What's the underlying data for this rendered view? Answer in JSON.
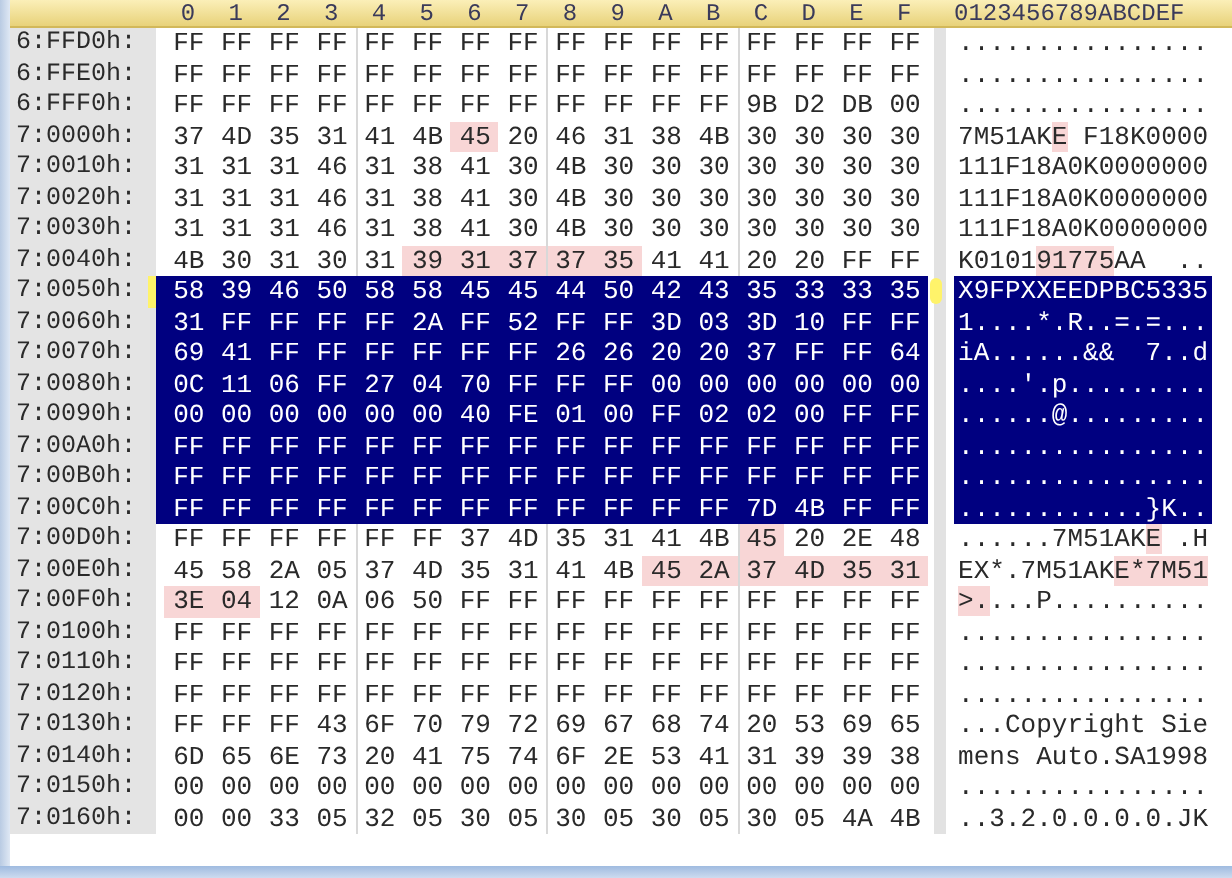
{
  "header": {
    "columns": [
      "0",
      "1",
      "2",
      "3",
      "4",
      "5",
      "6",
      "7",
      "8",
      "9",
      "A",
      "B",
      "C",
      "D",
      "E",
      "F"
    ],
    "ascii_title": "0123456789ABCDEF"
  },
  "rows": [
    {
      "address": "6:FFD0h:",
      "selected": false,
      "current": false,
      "bytes": [
        "FF",
        "FF",
        "FF",
        "FF",
        "FF",
        "FF",
        "FF",
        "FF",
        "FF",
        "FF",
        "FF",
        "FF",
        "FF",
        "FF",
        "FF",
        "FF"
      ],
      "highlighted": [
        false,
        false,
        false,
        false,
        false,
        false,
        false,
        false,
        false,
        false,
        false,
        false,
        false,
        false,
        false,
        false
      ],
      "ascii": "................"
    },
    {
      "address": "6:FFE0h:",
      "selected": false,
      "current": false,
      "bytes": [
        "FF",
        "FF",
        "FF",
        "FF",
        "FF",
        "FF",
        "FF",
        "FF",
        "FF",
        "FF",
        "FF",
        "FF",
        "FF",
        "FF",
        "FF",
        "FF"
      ],
      "highlighted": [
        false,
        false,
        false,
        false,
        false,
        false,
        false,
        false,
        false,
        false,
        false,
        false,
        false,
        false,
        false,
        false
      ],
      "ascii": "................"
    },
    {
      "address": "6:FFF0h:",
      "selected": false,
      "current": false,
      "bytes": [
        "FF",
        "FF",
        "FF",
        "FF",
        "FF",
        "FF",
        "FF",
        "FF",
        "FF",
        "FF",
        "FF",
        "FF",
        "9B",
        "D2",
        "DB",
        "00"
      ],
      "highlighted": [
        false,
        false,
        false,
        false,
        false,
        false,
        false,
        false,
        false,
        false,
        false,
        false,
        false,
        false,
        false,
        false
      ],
      "ascii": "................"
    },
    {
      "address": "7:0000h:",
      "selected": false,
      "current": false,
      "bytes": [
        "37",
        "4D",
        "35",
        "31",
        "41",
        "4B",
        "45",
        "20",
        "46",
        "31",
        "38",
        "4B",
        "30",
        "30",
        "30",
        "30"
      ],
      "highlighted": [
        false,
        false,
        false,
        false,
        false,
        false,
        true,
        false,
        false,
        false,
        false,
        false,
        false,
        false,
        false,
        false
      ],
      "ascii": "7M51AKE F18K0000"
    },
    {
      "address": "7:0010h:",
      "selected": false,
      "current": false,
      "bytes": [
        "31",
        "31",
        "31",
        "46",
        "31",
        "38",
        "41",
        "30",
        "4B",
        "30",
        "30",
        "30",
        "30",
        "30",
        "30",
        "30"
      ],
      "highlighted": [
        false,
        false,
        false,
        false,
        false,
        false,
        false,
        false,
        false,
        false,
        false,
        false,
        false,
        false,
        false,
        false
      ],
      "ascii": "111F18A0K0000000"
    },
    {
      "address": "7:0020h:",
      "selected": false,
      "current": false,
      "bytes": [
        "31",
        "31",
        "31",
        "46",
        "31",
        "38",
        "41",
        "30",
        "4B",
        "30",
        "30",
        "30",
        "30",
        "30",
        "30",
        "30"
      ],
      "highlighted": [
        false,
        false,
        false,
        false,
        false,
        false,
        false,
        false,
        false,
        false,
        false,
        false,
        false,
        false,
        false,
        false
      ],
      "ascii": "111F18A0K0000000"
    },
    {
      "address": "7:0030h:",
      "selected": false,
      "current": false,
      "bytes": [
        "31",
        "31",
        "31",
        "46",
        "31",
        "38",
        "41",
        "30",
        "4B",
        "30",
        "30",
        "30",
        "30",
        "30",
        "30",
        "30"
      ],
      "highlighted": [
        false,
        false,
        false,
        false,
        false,
        false,
        false,
        false,
        false,
        false,
        false,
        false,
        false,
        false,
        false,
        false
      ],
      "ascii": "111F18A0K0000000"
    },
    {
      "address": "7:0040h:",
      "selected": false,
      "current": false,
      "bytes": [
        "4B",
        "30",
        "31",
        "30",
        "31",
        "39",
        "31",
        "37",
        "37",
        "35",
        "41",
        "41",
        "20",
        "20",
        "FF",
        "FF"
      ],
      "highlighted": [
        false,
        false,
        false,
        false,
        false,
        true,
        true,
        true,
        true,
        true,
        false,
        false,
        false,
        false,
        false,
        false
      ],
      "ascii": "K010191775AA  .."
    },
    {
      "address": "7:0050h:",
      "selected": true,
      "current": true,
      "bytes": [
        "58",
        "39",
        "46",
        "50",
        "58",
        "58",
        "45",
        "45",
        "44",
        "50",
        "42",
        "43",
        "35",
        "33",
        "33",
        "35"
      ],
      "highlighted": [
        false,
        false,
        false,
        false,
        false,
        false,
        false,
        false,
        false,
        false,
        false,
        false,
        false,
        false,
        false,
        false
      ],
      "ascii": "X9FPXXEEDPBC5335"
    },
    {
      "address": "7:0060h:",
      "selected": true,
      "current": false,
      "bytes": [
        "31",
        "FF",
        "FF",
        "FF",
        "FF",
        "2A",
        "FF",
        "52",
        "FF",
        "FF",
        "3D",
        "03",
        "3D",
        "10",
        "FF",
        "FF"
      ],
      "highlighted": [
        false,
        false,
        false,
        false,
        false,
        false,
        false,
        false,
        false,
        false,
        false,
        false,
        false,
        false,
        false,
        false
      ],
      "ascii": "1....*.R..=.=..."
    },
    {
      "address": "7:0070h:",
      "selected": true,
      "current": false,
      "bytes": [
        "69",
        "41",
        "FF",
        "FF",
        "FF",
        "FF",
        "FF",
        "FF",
        "26",
        "26",
        "20",
        "20",
        "37",
        "FF",
        "FF",
        "64"
      ],
      "highlighted": [
        false,
        false,
        false,
        false,
        false,
        false,
        false,
        false,
        false,
        false,
        false,
        false,
        false,
        false,
        false,
        false
      ],
      "ascii": "iA......&&  7..d"
    },
    {
      "address": "7:0080h:",
      "selected": true,
      "current": false,
      "bytes": [
        "0C",
        "11",
        "06",
        "FF",
        "27",
        "04",
        "70",
        "FF",
        "FF",
        "FF",
        "00",
        "00",
        "00",
        "00",
        "00",
        "00"
      ],
      "highlighted": [
        false,
        false,
        false,
        false,
        false,
        false,
        false,
        false,
        false,
        false,
        false,
        false,
        false,
        false,
        false,
        false
      ],
      "ascii": "....'.p........."
    },
    {
      "address": "7:0090h:",
      "selected": true,
      "current": false,
      "bytes": [
        "00",
        "00",
        "00",
        "00",
        "00",
        "00",
        "40",
        "FE",
        "01",
        "00",
        "FF",
        "02",
        "02",
        "00",
        "FF",
        "FF"
      ],
      "highlighted": [
        false,
        false,
        false,
        false,
        false,
        false,
        false,
        false,
        false,
        false,
        false,
        false,
        false,
        false,
        false,
        false
      ],
      "ascii": "......@........."
    },
    {
      "address": "7:00A0h:",
      "selected": true,
      "current": false,
      "bytes": [
        "FF",
        "FF",
        "FF",
        "FF",
        "FF",
        "FF",
        "FF",
        "FF",
        "FF",
        "FF",
        "FF",
        "FF",
        "FF",
        "FF",
        "FF",
        "FF"
      ],
      "highlighted": [
        false,
        false,
        false,
        false,
        false,
        false,
        false,
        false,
        false,
        false,
        false,
        false,
        false,
        false,
        false,
        false
      ],
      "ascii": "................"
    },
    {
      "address": "7:00B0h:",
      "selected": true,
      "current": false,
      "bytes": [
        "FF",
        "FF",
        "FF",
        "FF",
        "FF",
        "FF",
        "FF",
        "FF",
        "FF",
        "FF",
        "FF",
        "FF",
        "FF",
        "FF",
        "FF",
        "FF"
      ],
      "highlighted": [
        false,
        false,
        false,
        false,
        false,
        false,
        false,
        false,
        false,
        false,
        false,
        false,
        false,
        false,
        false,
        false
      ],
      "ascii": "................"
    },
    {
      "address": "7:00C0h:",
      "selected": true,
      "current": false,
      "bytes": [
        "FF",
        "FF",
        "FF",
        "FF",
        "FF",
        "FF",
        "FF",
        "FF",
        "FF",
        "FF",
        "FF",
        "FF",
        "7D",
        "4B",
        "FF",
        "FF"
      ],
      "highlighted": [
        false,
        false,
        false,
        false,
        false,
        false,
        false,
        false,
        false,
        false,
        false,
        false,
        false,
        false,
        false,
        false
      ],
      "ascii": "............}K.."
    },
    {
      "address": "7:00D0h:",
      "selected": false,
      "current": false,
      "bytes": [
        "FF",
        "FF",
        "FF",
        "FF",
        "FF",
        "FF",
        "37",
        "4D",
        "35",
        "31",
        "41",
        "4B",
        "45",
        "20",
        "2E",
        "48"
      ],
      "highlighted": [
        false,
        false,
        false,
        false,
        false,
        false,
        false,
        false,
        false,
        false,
        false,
        false,
        true,
        false,
        false,
        false
      ],
      "ascii": "......7M51AKE .H"
    },
    {
      "address": "7:00E0h:",
      "selected": false,
      "current": false,
      "bytes": [
        "45",
        "58",
        "2A",
        "05",
        "37",
        "4D",
        "35",
        "31",
        "41",
        "4B",
        "45",
        "2A",
        "37",
        "4D",
        "35",
        "31"
      ],
      "highlighted": [
        false,
        false,
        false,
        false,
        false,
        false,
        false,
        false,
        false,
        false,
        true,
        true,
        true,
        true,
        true,
        true
      ],
      "ascii": "EX*.7M51AKE*7M51"
    },
    {
      "address": "7:00F0h:",
      "selected": false,
      "current": false,
      "bytes": [
        "3E",
        "04",
        "12",
        "0A",
        "06",
        "50",
        "FF",
        "FF",
        "FF",
        "FF",
        "FF",
        "FF",
        "FF",
        "FF",
        "FF",
        "FF"
      ],
      "highlighted": [
        true,
        true,
        false,
        false,
        false,
        false,
        false,
        false,
        false,
        false,
        false,
        false,
        false,
        false,
        false,
        false
      ],
      "ascii": ">....P.........."
    },
    {
      "address": "7:0100h:",
      "selected": false,
      "current": false,
      "bytes": [
        "FF",
        "FF",
        "FF",
        "FF",
        "FF",
        "FF",
        "FF",
        "FF",
        "FF",
        "FF",
        "FF",
        "FF",
        "FF",
        "FF",
        "FF",
        "FF"
      ],
      "highlighted": [
        false,
        false,
        false,
        false,
        false,
        false,
        false,
        false,
        false,
        false,
        false,
        false,
        false,
        false,
        false,
        false
      ],
      "ascii": "................"
    },
    {
      "address": "7:0110h:",
      "selected": false,
      "current": false,
      "bytes": [
        "FF",
        "FF",
        "FF",
        "FF",
        "FF",
        "FF",
        "FF",
        "FF",
        "FF",
        "FF",
        "FF",
        "FF",
        "FF",
        "FF",
        "FF",
        "FF"
      ],
      "highlighted": [
        false,
        false,
        false,
        false,
        false,
        false,
        false,
        false,
        false,
        false,
        false,
        false,
        false,
        false,
        false,
        false
      ],
      "ascii": "................"
    },
    {
      "address": "7:0120h:",
      "selected": false,
      "current": false,
      "bytes": [
        "FF",
        "FF",
        "FF",
        "FF",
        "FF",
        "FF",
        "FF",
        "FF",
        "FF",
        "FF",
        "FF",
        "FF",
        "FF",
        "FF",
        "FF",
        "FF"
      ],
      "highlighted": [
        false,
        false,
        false,
        false,
        false,
        false,
        false,
        false,
        false,
        false,
        false,
        false,
        false,
        false,
        false,
        false
      ],
      "ascii": "................"
    },
    {
      "address": "7:0130h:",
      "selected": false,
      "current": false,
      "bytes": [
        "FF",
        "FF",
        "FF",
        "43",
        "6F",
        "70",
        "79",
        "72",
        "69",
        "67",
        "68",
        "74",
        "20",
        "53",
        "69",
        "65"
      ],
      "highlighted": [
        false,
        false,
        false,
        false,
        false,
        false,
        false,
        false,
        false,
        false,
        false,
        false,
        false,
        false,
        false,
        false
      ],
      "ascii": "...Copyright Sie"
    },
    {
      "address": "7:0140h:",
      "selected": false,
      "current": false,
      "bytes": [
        "6D",
        "65",
        "6E",
        "73",
        "20",
        "41",
        "75",
        "74",
        "6F",
        "2E",
        "53",
        "41",
        "31",
        "39",
        "39",
        "38"
      ],
      "highlighted": [
        false,
        false,
        false,
        false,
        false,
        false,
        false,
        false,
        false,
        false,
        false,
        false,
        false,
        false,
        false,
        false
      ],
      "ascii": "mens Auto.SA1998"
    },
    {
      "address": "7:0150h:",
      "selected": false,
      "current": false,
      "bytes": [
        "00",
        "00",
        "00",
        "00",
        "00",
        "00",
        "00",
        "00",
        "00",
        "00",
        "00",
        "00",
        "00",
        "00",
        "00",
        "00"
      ],
      "highlighted": [
        false,
        false,
        false,
        false,
        false,
        false,
        false,
        false,
        false,
        false,
        false,
        false,
        false,
        false,
        false,
        false
      ],
      "ascii": "................"
    },
    {
      "address": "7:0160h:",
      "selected": false,
      "current": false,
      "bytes": [
        "00",
        "00",
        "33",
        "05",
        "32",
        "05",
        "30",
        "05",
        "30",
        "05",
        "30",
        "05",
        "30",
        "05",
        "4A",
        "4B"
      ],
      "highlighted": [
        false,
        false,
        false,
        false,
        false,
        false,
        false,
        false,
        false,
        false,
        false,
        false,
        false,
        false,
        false,
        false
      ],
      "ascii": "..3.2.0.0.0.0.JK"
    }
  ]
}
